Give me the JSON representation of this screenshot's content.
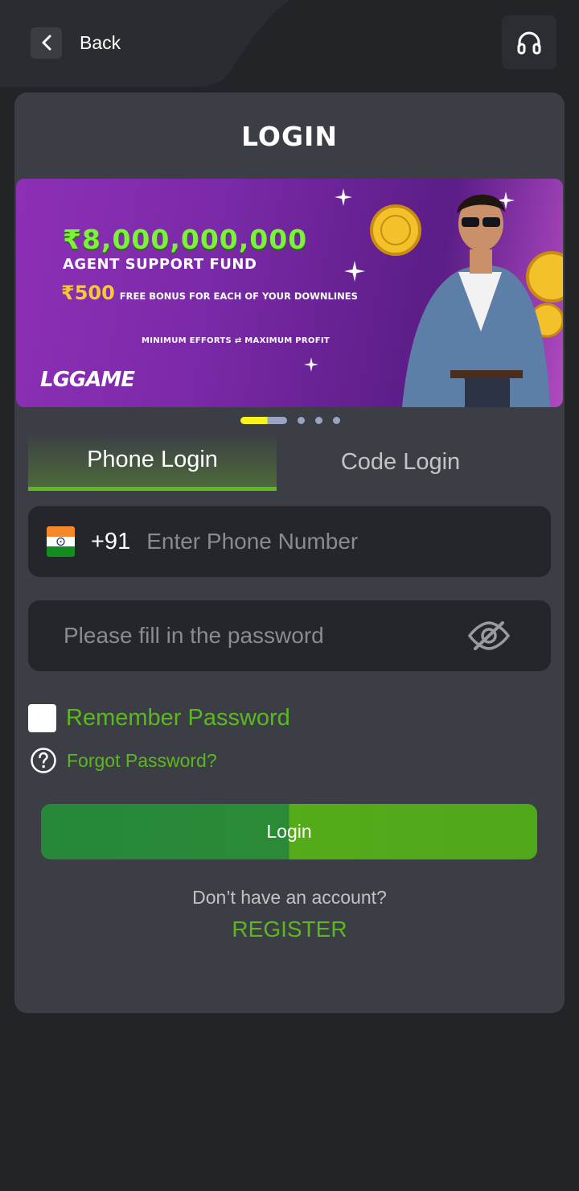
{
  "header": {
    "back_label": "Back"
  },
  "page": {
    "title": "LOGIN"
  },
  "banner": {
    "amount": "₹8,000,000,000",
    "fund": "AGENT SUPPORT FUND",
    "bonus_amount": "₹500",
    "bonus_text": "FREE BONUS FOR EACH OF YOUR DOWNLINES",
    "effort": "MINIMUM EFFORTS ⇄ MAXIMUM PROFIT",
    "logo": "LGGAME",
    "slide_count": 4,
    "active_slide": 1
  },
  "tabs": [
    {
      "label": "Phone Login",
      "active": true
    },
    {
      "label": "Code Login",
      "active": false
    }
  ],
  "phone": {
    "country_code": "+91",
    "placeholder": "Enter Phone Number",
    "flag_icon": "india-flag-icon"
  },
  "password": {
    "placeholder": "Please fill in the password",
    "visibility_icon": "eye-slash-icon"
  },
  "remember": {
    "label": "Remember Password",
    "checked": false
  },
  "forgot": {
    "label": "Forgot Password?"
  },
  "actions": {
    "login_label": "Login",
    "no_account_text": "Don’t have an account?",
    "register_label": "REGISTER"
  },
  "colors": {
    "accent_green": "#5cb81f",
    "background": "#232428",
    "card": "#3c3e45",
    "input": "#25262b"
  }
}
